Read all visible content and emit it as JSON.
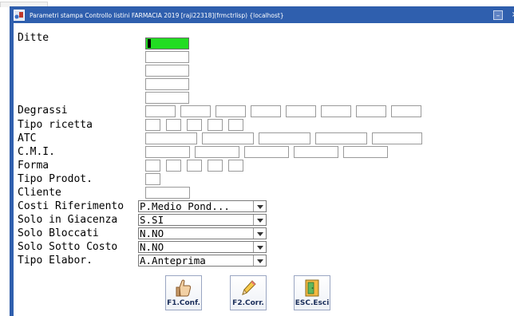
{
  "window": {
    "title": "Parametri stampa Controllo listini FARMACIA 2019 [raji22318](frmctrlisp) {localhost}",
    "minimize_glyph": "–",
    "close_glyph": "×"
  },
  "labels": {
    "ditte": "Ditte",
    "degrassi": "Degrassi",
    "tipo_ricetta": "Tipo ricetta",
    "atc": "ATC",
    "cmi": "C.M.I.",
    "forma": "Forma",
    "tipo_prodot": "Tipo Prodot.",
    "cliente": "Cliente",
    "costi_riferimento": "Costi Riferimento",
    "solo_giacenza": "Solo in Giacenza",
    "solo_bloccati": "Solo Bloccati",
    "solo_sotto_costo": "Solo Sotto Costo",
    "tipo_elabor": "Tipo Elabor."
  },
  "combos": {
    "costi_riferimento": "P.Medio Pond...",
    "solo_giacenza": "S.SI",
    "solo_bloccati": "N.NO",
    "solo_sotto_costo": "N.NO",
    "tipo_elabor": "A.Anteprima"
  },
  "buttons": {
    "confirm": "F1.Conf.",
    "correct": "F2.Corr.",
    "exit": "ESC.Esci"
  },
  "colors": {
    "titlebar": "#2f5fae",
    "active_field": "#22dd22",
    "button_text": "#1a2e5a"
  },
  "icons": {
    "app": "app-icon",
    "confirm": "thumbs-up-icon",
    "correct": "pencil-icon",
    "exit": "exit-door-icon"
  }
}
